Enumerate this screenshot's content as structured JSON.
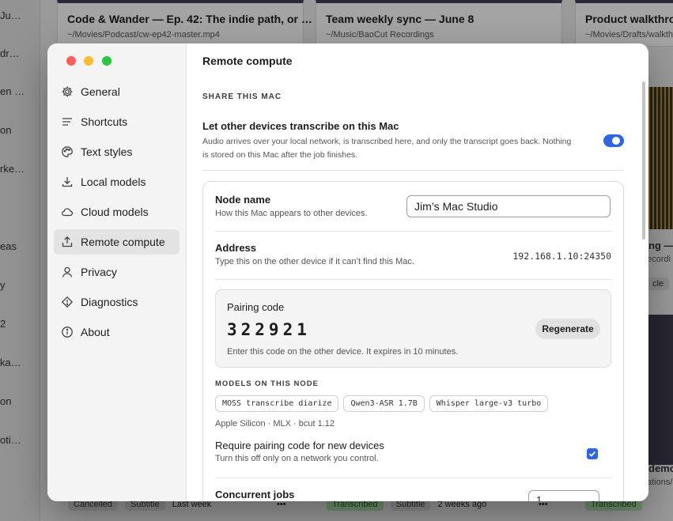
{
  "background": {
    "sidebar_items": [
      "Ju…",
      "dr…",
      "en …",
      "on",
      "rke…",
      "eas",
      "y",
      "2",
      "ka…",
      "on",
      "oti…"
    ],
    "cards": [
      {
        "title": "Code & Wander — Ep. 42: The indie path, or …",
        "path": "~/Movies/Podcast/cw-ep42-master.mp4"
      },
      {
        "title": "Team weekly sync — June 8",
        "path": "~/Music/BaoCut Recordings"
      },
      {
        "title": "Product walkthrou",
        "path": "~/Movies/Drafts/walkthro"
      }
    ],
    "right_fragments": [
      "ng — ",
      "ecordi",
      "cle",
      "5",
      "demo",
      "ations/"
    ],
    "footer_left": {
      "status": "Cancelled",
      "type": "Subtitle",
      "time": "Last week",
      "more": "•••"
    },
    "footer_mid": {
      "status": "Transcribed",
      "type": "Subtitle",
      "time": "2 weeks ago",
      "more": "•••"
    },
    "footer_right": {
      "status": "Transcribed"
    }
  },
  "colors": {
    "accent": "#2f63e8",
    "close": "#ff5f57",
    "minimize": "#febc2e",
    "zoom": "#28c840"
  },
  "sidebar": {
    "items": [
      {
        "label": "General",
        "icon": "gear-icon"
      },
      {
        "label": "Shortcuts",
        "icon": "lines-icon"
      },
      {
        "label": "Text styles",
        "icon": "palette-icon"
      },
      {
        "label": "Local models",
        "icon": "download-icon"
      },
      {
        "label": "Cloud models",
        "icon": "cloud-icon"
      },
      {
        "label": "Remote compute",
        "icon": "upload-icon",
        "active": true
      },
      {
        "label": "Privacy",
        "icon": "person-icon"
      },
      {
        "label": "Diagnostics",
        "icon": "diamond-icon"
      },
      {
        "label": "About",
        "icon": "info-icon"
      }
    ]
  },
  "content": {
    "title": "Remote compute",
    "share_section": "SHARE THIS MAC",
    "share_toggle": {
      "title": "Let other devices transcribe on this Mac",
      "desc_line1": "Audio arrives over your local network, is transcribed here, and only the transcript goes back. Nothing",
      "desc_line2": "is stored on this Mac after the job finishes.",
      "enabled": true
    },
    "node_name": {
      "label": "Node name",
      "desc": "How this Mac appears to other devices.",
      "value": "Jim’s Mac Studio"
    },
    "address": {
      "label": "Address",
      "desc": "Type this on the other device if it can’t find this Mac.",
      "value": "192.168.1.10:24350"
    },
    "pairing": {
      "label": "Pairing code",
      "code": "322921",
      "button": "Regenerate",
      "desc": "Enter this code on the other device. It expires in 10 minutes."
    },
    "models_section": "MODELS ON THIS NODE",
    "models": [
      "MOSS transcribe diarize",
      "Qwen3-ASR 1.7B",
      "Whisper large-v3 turbo"
    ],
    "platform": "Apple Silicon · MLX · bcut 1.12",
    "require_pairing": {
      "title": "Require pairing code for new devices",
      "desc": "Turn this off only on a network you control.",
      "checked": true
    },
    "concurrent": {
      "label": "Concurrent jobs",
      "value": "1"
    }
  }
}
